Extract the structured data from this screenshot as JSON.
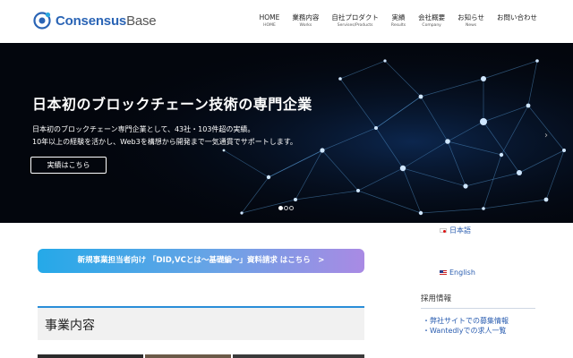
{
  "header": {
    "logo_main": "Consensus",
    "logo_sub": "Base",
    "nav": [
      {
        "ja": "HOME",
        "en": "HOME"
      },
      {
        "ja": "業務内容",
        "en": "Works"
      },
      {
        "ja": "自社プロダクト",
        "en": "Servises/Products"
      },
      {
        "ja": "実績",
        "en": "Results"
      },
      {
        "ja": "会社概要",
        "en": "Company"
      },
      {
        "ja": "お知らせ",
        "en": "News"
      },
      {
        "ja": "お問い合わせ",
        "en": ""
      }
    ]
  },
  "hero": {
    "title": "日本初のブロックチェーン技術の専門企業",
    "desc_line1": "日本初のブロックチェーン専門企業として、43社・103件超の実績。",
    "desc_line2": "10年以上の経験を活かし、Web3を構想から開発まで一気通貫でサポートします。",
    "button": "実績はこちら",
    "next_arrow": "›",
    "slides": 3,
    "active_slide": 1
  },
  "main": {
    "banner": "新規事業担当者向け 「DID,VCとは〜基礎編〜」資料請求 はこちら　>",
    "section_title": "事業内容"
  },
  "sidebar": {
    "lang_ja": "日本語",
    "lang_en": "English",
    "recruit_title": "採用情報",
    "links": [
      "・弊社サイトでの募集情報",
      "・Wantedlyでの求人一覧"
    ]
  },
  "colors": {
    "brand": "#2a64b5",
    "accent": "#2a8ed8",
    "banner_start": "#25a9e8",
    "banner_end": "#a98ae4",
    "hero_bg": "#03060d"
  }
}
